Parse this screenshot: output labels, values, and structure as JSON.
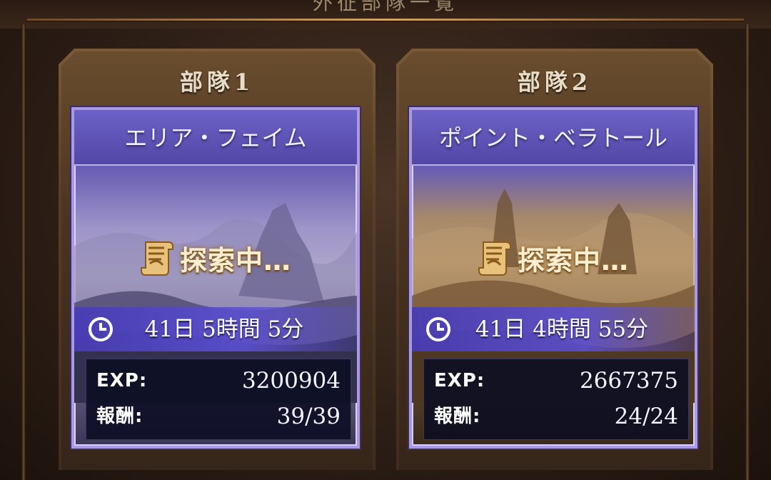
{
  "screen_title": "外征部隊一覧",
  "parties": [
    {
      "name": "部隊1",
      "area": "エリア・フェイム",
      "status": "探索中…",
      "time_remaining": "41日 5時間 5分",
      "exp_label": "EXP:",
      "exp_value": "3200904",
      "reward_label": "報酬:",
      "reward_value": "39/39"
    },
    {
      "name": "部隊2",
      "area": "ポイント・ベラトール",
      "status": "探索中…",
      "time_remaining": "41日 4時間 55分",
      "exp_label": "EXP:",
      "exp_value": "2667375",
      "reward_label": "報酬:",
      "reward_value": "24/24"
    }
  ],
  "icons": {
    "status": "scroll-icon",
    "timer": "clock-icon"
  },
  "colors": {
    "frame_gold": "#d2a461",
    "card_border": "#a99ae3",
    "timer_bar": "#5c50d2",
    "stats_bg": "#0a0c22",
    "status_text": "#fbeed2"
  }
}
